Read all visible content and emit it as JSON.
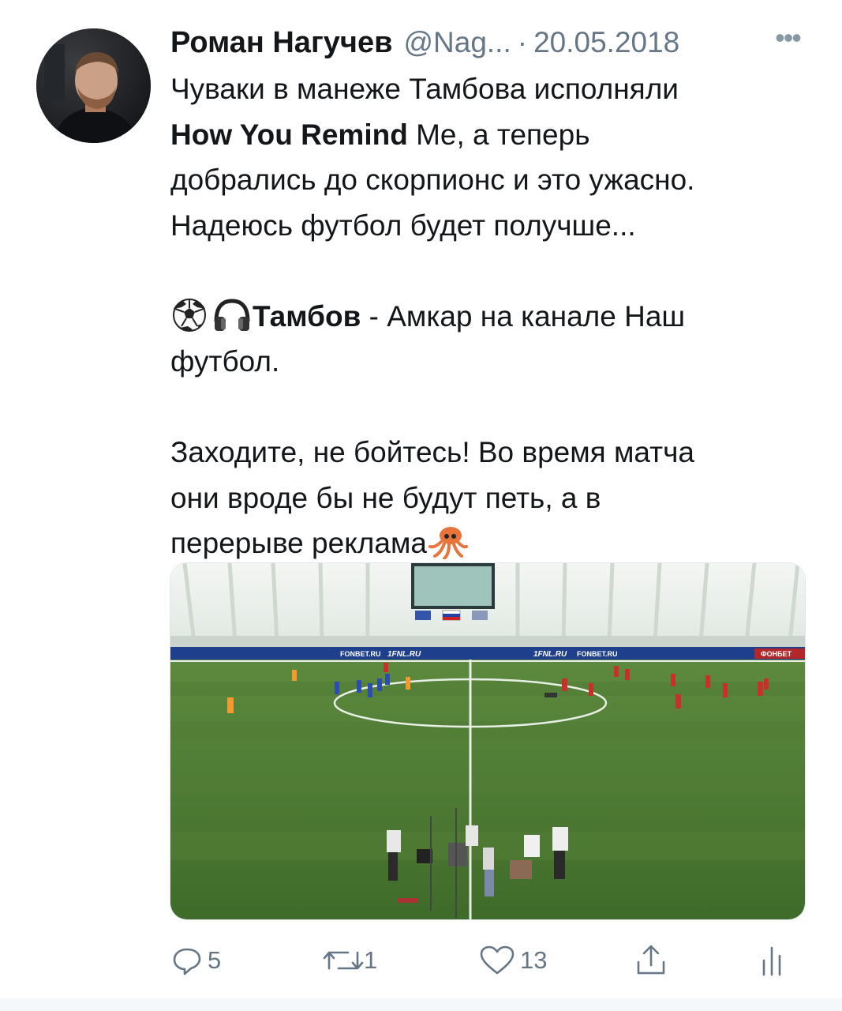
{
  "tweet": {
    "author_name": "Роман Нагучев",
    "author_handle": "@Nag...",
    "separator": "·",
    "date": "20.05.2018",
    "more_label": "•••",
    "lines": {
      "l1": "Чуваки в манеже Тамбова исполняли",
      "l2_bold": "How You Remind",
      "l2_rest": " Me, а теперь",
      "l3": "добрались до скорпионс и это ужасно.",
      "l4": "Надеюсь футбол будет получше...",
      "l5_bold": "Тамбов",
      "l5_rest": " - Амкар на канале Наш",
      "l6": "футбол.",
      "l7": "Заходите, не бойтесь! Во время матча",
      "l8": "они вроде бы не будут петь, а в",
      "l9": "перерыве реклама"
    },
    "emojis": [
      "soccer-ball",
      "headphones",
      "squid"
    ]
  },
  "media": {
    "ad_boards": [
      "FONBET.RU",
      "1FNL.RU",
      "1FNL.RU",
      "FONBET.RU",
      "ФОНБЕТ"
    ]
  },
  "actions": {
    "reply_count": "5",
    "retweet_count": "1",
    "like_count": "13"
  },
  "colors": {
    "text": "#14171a",
    "secondary": "#657786",
    "pitch": "#3f6b2a"
  }
}
